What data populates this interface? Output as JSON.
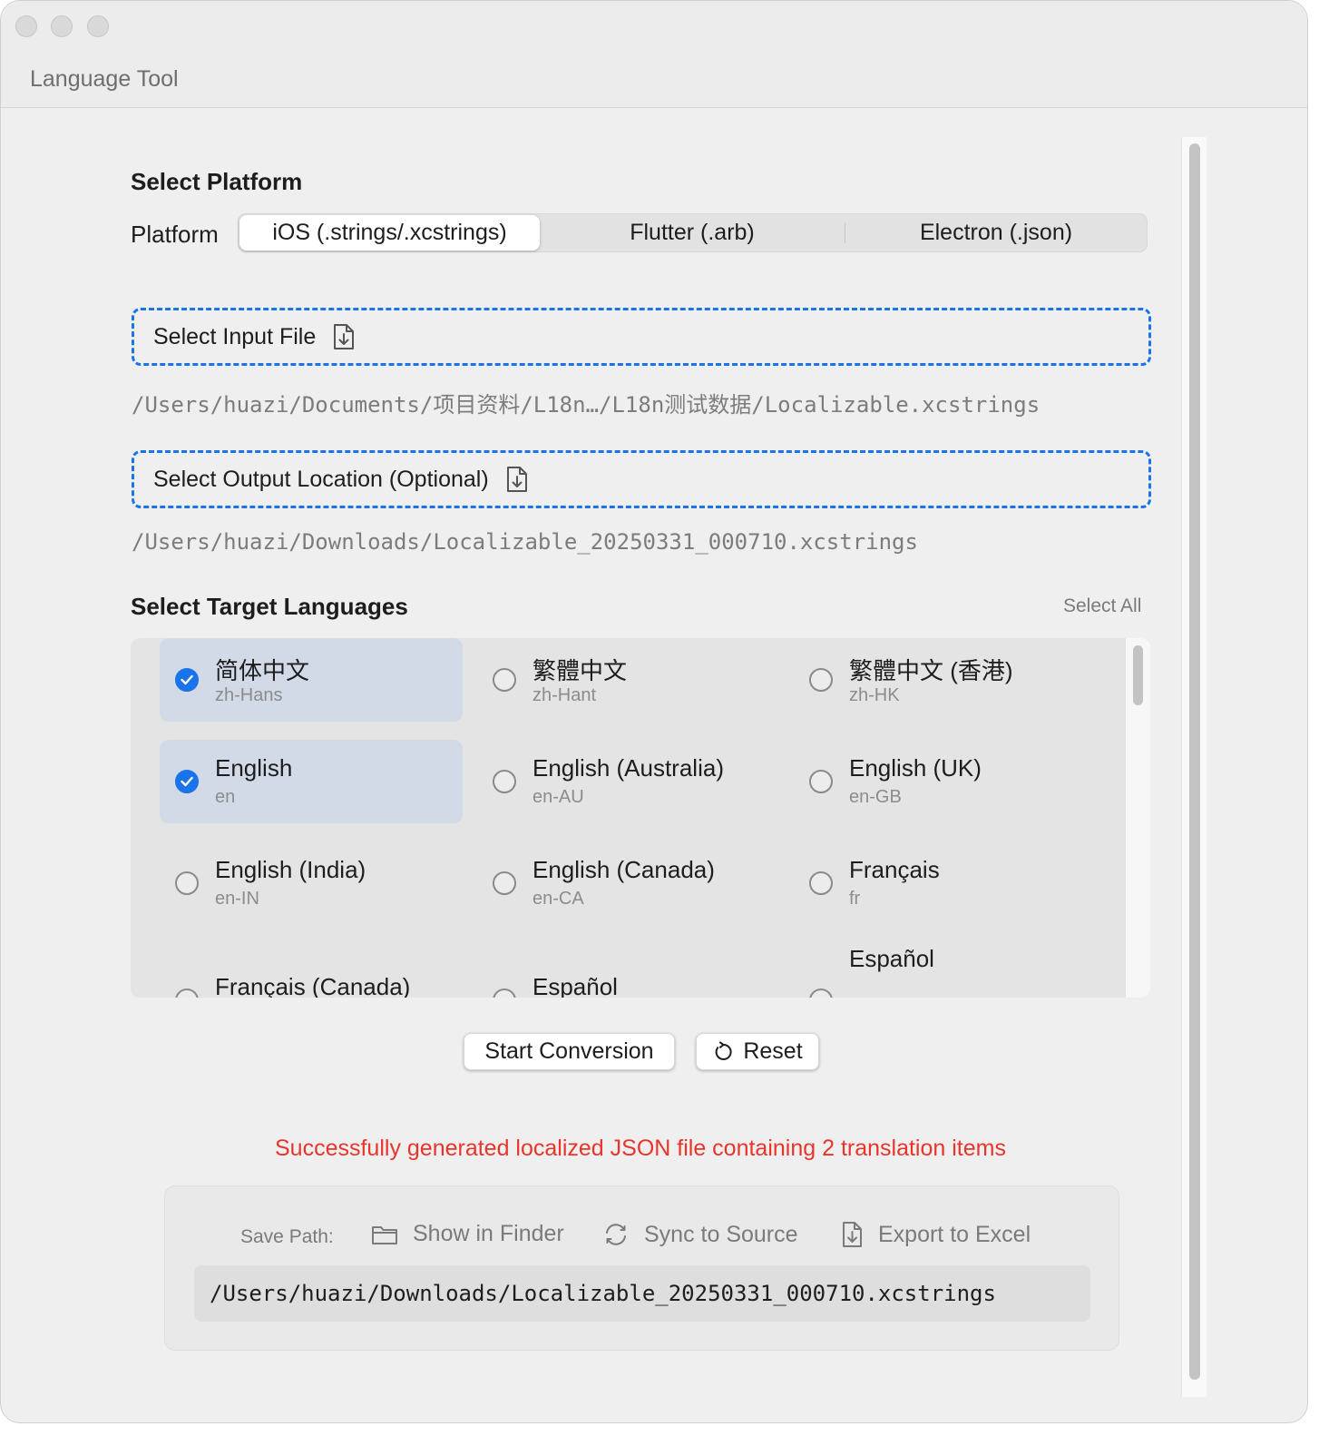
{
  "window": {
    "title": "Language Tool"
  },
  "platform": {
    "section_title": "Select Platform",
    "label": "Platform",
    "options": [
      "iOS (.strings/.xcstrings)",
      "Flutter (.arb)",
      "Electron (.json)"
    ],
    "selected": "iOS (.strings/.xcstrings)"
  },
  "input_file": {
    "button_label": "Select Input File",
    "path": "/Users/huazi/Documents/项目资料/L18n…/L18n测试数据/Localizable.xcstrings"
  },
  "output_location": {
    "button_label": "Select Output Location (Optional)",
    "path": "/Users/huazi/Downloads/Localizable_20250331_000710.xcstrings"
  },
  "languages": {
    "section_title": "Select Target Languages",
    "select_all_label": "Select All",
    "items": [
      {
        "name": "简体中文",
        "code": "zh-Hans",
        "selected": true
      },
      {
        "name": "繁體中文",
        "code": "zh-Hant",
        "selected": false
      },
      {
        "name": "繁體中文 (香港)",
        "code": "zh-HK",
        "selected": false
      },
      {
        "name": "English",
        "code": "en",
        "selected": true
      },
      {
        "name": "English (Australia)",
        "code": "en-AU",
        "selected": false
      },
      {
        "name": "English (UK)",
        "code": "en-GB",
        "selected": false
      },
      {
        "name": "English (India)",
        "code": "en-IN",
        "selected": false
      },
      {
        "name": "English (Canada)",
        "code": "en-CA",
        "selected": false
      },
      {
        "name": "Français",
        "code": "fr",
        "selected": false
      },
      {
        "name": "Français (Canada)",
        "code": "",
        "selected": false
      },
      {
        "name": "Español",
        "code": "",
        "selected": false
      },
      {
        "name": "Español",
        "code": "",
        "selected": false
      }
    ]
  },
  "actions": {
    "start_label": "Start Conversion",
    "reset_label": "Reset"
  },
  "result": {
    "message": "Successfully generated localized JSON file containing 2 translation items",
    "message_color": "#e8352b",
    "save_path_label": "Save Path:",
    "show_in_finder_label": "Show in Finder",
    "sync_to_source_label": "Sync to Source",
    "export_to_excel_label": "Export to Excel",
    "saved_path": "/Users/huazi/Downloads/Localizable_20250331_000710.xcstrings"
  },
  "colors": {
    "accent": "#1a73e8",
    "selected_item_bg": "#d1dae6"
  }
}
